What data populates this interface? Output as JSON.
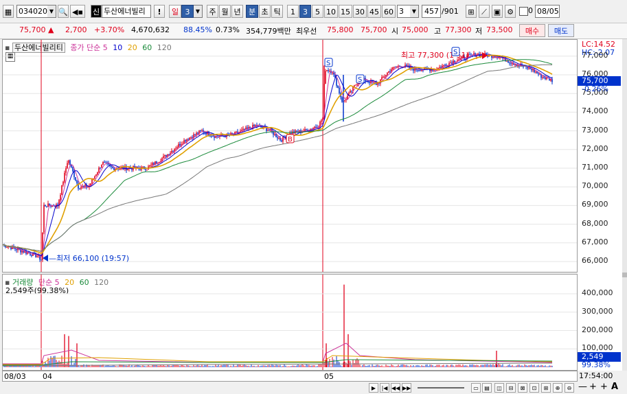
{
  "toolbar": {
    "code": "034020",
    "credit_badge": "신",
    "stock_name": "두산에너빌리",
    "alert": "!",
    "period_day": "일",
    "period_count": "3",
    "week": "주",
    "month": "월",
    "year": "년",
    "minute": "분",
    "second": "초",
    "tick": "틱",
    "intervals": [
      "1",
      "3",
      "5",
      "10",
      "15",
      "30",
      "45",
      "60"
    ],
    "interval_value": "3",
    "count": "457",
    "total": "/901",
    "time_value": "0",
    "date_value": "08/05"
  },
  "quote": {
    "price": "75,700",
    "change": "2,700",
    "change_pct": "+3.70%",
    "volume": "4,670,632",
    "vol_ratio": "88.45%",
    "turnover": "0.73%",
    "amount": "354,779백만",
    "best_label": "최우선",
    "ask": "75,800",
    "bid": "75,700",
    "open_label": "시",
    "open": "75,000",
    "high_label": "고",
    "high": "77,300",
    "low_label": "저",
    "low": "73,500",
    "sell_btn": "매수",
    "buy_btn": "매도"
  },
  "price_legend": {
    "name": "두산에너빌리티",
    "type": "종가 단순",
    "periods": [
      "5",
      "10",
      "20",
      "60",
      "120"
    ]
  },
  "volume_legend": {
    "name": "거래량",
    "type": "단순",
    "periods": [
      "5",
      "20",
      "60",
      "120"
    ],
    "current": "2,549주(99.38%)"
  },
  "price_axis": {
    "lc": "LC:14.52",
    "hc": "HC:-2.07",
    "ticks": [
      "77,000",
      "76,000",
      "75,000",
      "74,000",
      "73,000",
      "72,000",
      "71,000",
      "70,000",
      "69,000",
      "68,000",
      "67,000",
      "66,000"
    ],
    "current": "75,700",
    "current_pct": "-0.26%"
  },
  "volume_axis": {
    "ticks": [
      "400,000",
      "300,000",
      "200,000",
      "100,000"
    ],
    "current": "2,549",
    "current_pct": "99.38%"
  },
  "x_axis": {
    "labels": [
      "08/03",
      "04",
      "05"
    ],
    "time": "17:54:00"
  },
  "annotations": {
    "high": "최고 77,300 (1 51)",
    "low": "최저 66,100 (19:57)",
    "signal_s": "S",
    "signal_b": "B"
  },
  "colors": {
    "ma5": "#cc3399",
    "ma10": "#0000cc",
    "ma20": "#e0a000",
    "ma60": "#1a8a3a",
    "ma120": "#777777",
    "up": "#e0001b",
    "down": "#0033cc"
  },
  "chart_data": {
    "type": "line",
    "symbol": "034020",
    "interval": "3분",
    "y_range": [
      65500,
      78000
    ],
    "close_keypoints": [
      [
        0,
        66900
      ],
      [
        50,
        66300
      ],
      [
        56,
        66100
      ],
      [
        60,
        69000
      ],
      [
        80,
        69000
      ],
      [
        95,
        71500
      ],
      [
        110,
        70000
      ],
      [
        125,
        70000
      ],
      [
        145,
        71300
      ],
      [
        160,
        71000
      ],
      [
        185,
        71000
      ],
      [
        210,
        71000
      ],
      [
        235,
        71600
      ],
      [
        265,
        72500
      ],
      [
        290,
        73000
      ],
      [
        310,
        72700
      ],
      [
        335,
        72800
      ],
      [
        370,
        73300
      ],
      [
        390,
        73000
      ],
      [
        405,
        72500
      ],
      [
        420,
        72900
      ],
      [
        440,
        73000
      ],
      [
        460,
        73300
      ],
      [
        466,
        73700
      ],
      [
        469,
        76300
      ],
      [
        480,
        76200
      ],
      [
        495,
        74500
      ],
      [
        505,
        75000
      ],
      [
        520,
        75800
      ],
      [
        545,
        75500
      ],
      [
        565,
        76300
      ],
      [
        580,
        76500
      ],
      [
        600,
        76300
      ],
      [
        630,
        76300
      ],
      [
        660,
        76800
      ],
      [
        690,
        77100
      ],
      [
        720,
        77000
      ],
      [
        745,
        76600
      ],
      [
        770,
        76300
      ],
      [
        785,
        75900
      ],
      [
        800,
        75700
      ]
    ],
    "volume_peak": 450000,
    "volume_current": 2549,
    "volume_range": [
      0,
      450000
    ],
    "ma_periods": [
      5,
      10,
      20,
      60,
      120
    ]
  }
}
